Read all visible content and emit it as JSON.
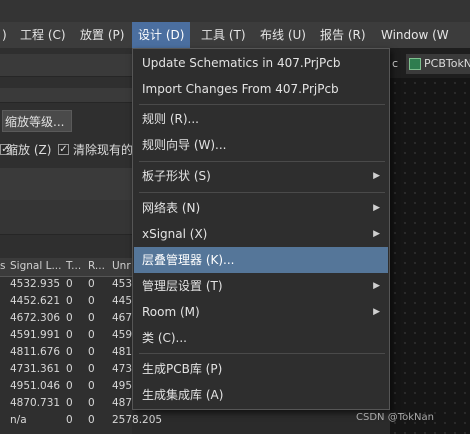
{
  "menubar": {
    "items": [
      {
        "label": ")"
      },
      {
        "label": "工程 (C)"
      },
      {
        "label": "放置 (P)"
      },
      {
        "label": "设计 (D)"
      },
      {
        "label": "工具 (T)"
      },
      {
        "label": "布线 (U)"
      },
      {
        "label": "报告 (R)"
      },
      {
        "label": "Window (W"
      }
    ]
  },
  "left_panel": {
    "zoom_button": "缩放等级...",
    "zoom_checkbox": "缩放 (Z)",
    "clear_checkbox": "清除现有的",
    "table": {
      "headers": [
        "s",
        "Signal L...",
        "T...",
        "R...",
        "Unr"
      ],
      "rows": [
        [
          "",
          "4532.935",
          "0",
          "0",
          "453"
        ],
        [
          "",
          "4452.621",
          "0",
          "0",
          "445"
        ],
        [
          "",
          "4672.306",
          "0",
          "0",
          "467"
        ],
        [
          "",
          "4591.991",
          "0",
          "0",
          "459"
        ],
        [
          "",
          "4811.676",
          "0",
          "0",
          "481"
        ],
        [
          "",
          "4731.361",
          "0",
          "0",
          "473"
        ],
        [
          "",
          "4951.046",
          "0",
          "0",
          "495"
        ],
        [
          "",
          "4870.731",
          "0",
          "0",
          "487"
        ],
        [
          "",
          "n/a",
          "0",
          "0",
          "2578.205"
        ]
      ]
    }
  },
  "tabs": [
    {
      "label": "c"
    },
    {
      "label": "PCBTokN"
    }
  ],
  "dropdown": {
    "items": [
      {
        "label": "Update Schematics in 407.PrjPcb",
        "submenu": false
      },
      {
        "label": "Import Changes From 407.PrjPcb",
        "submenu": false
      },
      {
        "label": "规则 (R)...",
        "submenu": false
      },
      {
        "label": "规则向导 (W)...",
        "submenu": false
      },
      {
        "label": "板子形状 (S)",
        "submenu": true
      },
      {
        "label": "网络表 (N)",
        "submenu": true
      },
      {
        "label": "xSignal (X)",
        "submenu": true
      },
      {
        "label": "层叠管理器 (K)...",
        "submenu": false,
        "highlighted": true
      },
      {
        "label": "管理层设置 (T)",
        "submenu": true
      },
      {
        "label": "Room (M)",
        "submenu": true
      },
      {
        "label": "类 (C)...",
        "submenu": false
      },
      {
        "label": "生成PCB库 (P)",
        "submenu": false
      },
      {
        "label": "生成集成库 (A)",
        "submenu": false
      }
    ]
  },
  "watermark": "CSDN @TokNan",
  "colors": {
    "highlight": "#557699",
    "menubar_active": "#4b6fa0",
    "background": "#2b2b2b"
  }
}
